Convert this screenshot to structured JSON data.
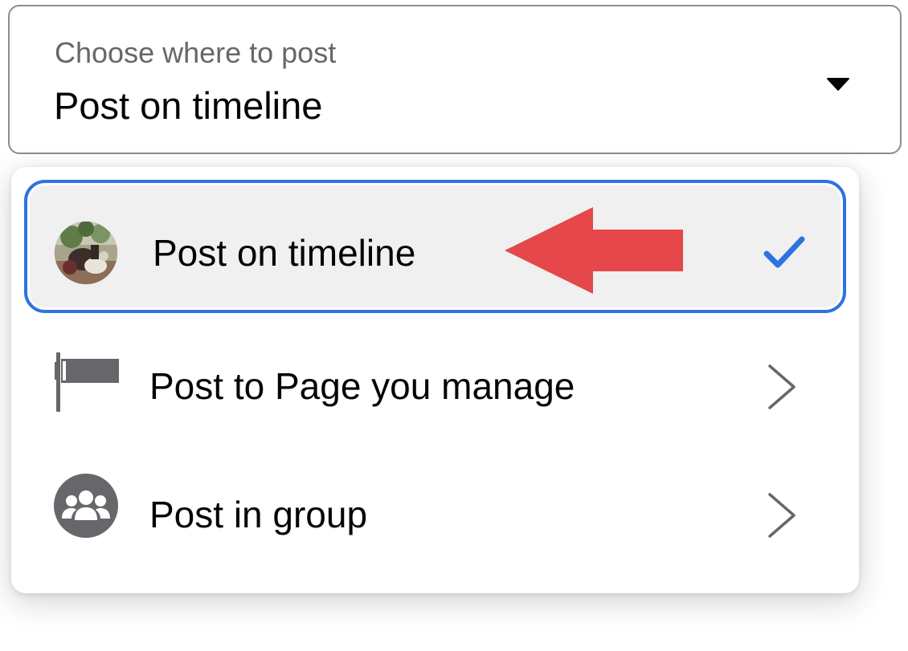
{
  "select": {
    "label": "Choose where to post",
    "value": "Post on timeline",
    "caret_icon": "caret-down-icon"
  },
  "menu": {
    "items": [
      {
        "label": "Post on timeline",
        "icon": "profile-avatar-icon",
        "trailing_icon": "checkmark-icon",
        "selected": true
      },
      {
        "label": "Post to Page you manage",
        "icon": "flag-icon",
        "trailing_icon": "chevron-right-icon",
        "selected": false
      },
      {
        "label": "Post in group",
        "icon": "group-icon",
        "trailing_icon": "chevron-right-icon",
        "selected": false
      }
    ]
  },
  "annotation": {
    "icon": "red-arrow-left-icon"
  },
  "colors": {
    "accent": "#2d73e2",
    "arrow": "#e5474a",
    "icon_gray": "#65676b",
    "border_gray": "#8a8d91",
    "selected_bg": "#f0f0f0"
  }
}
